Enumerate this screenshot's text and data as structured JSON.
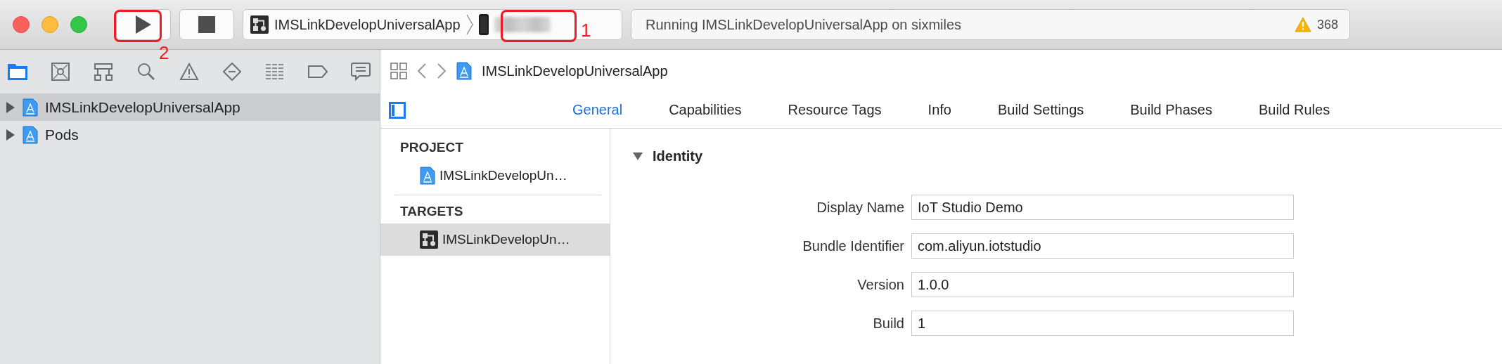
{
  "toolbar": {
    "scheme": "IMSLinkDevelopUniversalApp",
    "activity": "Running IMSLinkDevelopUniversalApp on sixmiles",
    "warning_count": "368"
  },
  "annotations": [
    {
      "kind": "device",
      "label": "1"
    },
    {
      "kind": "run",
      "label": "2"
    }
  ],
  "navigator": {
    "tabs": [
      {
        "kind": "folder",
        "selected": true
      },
      {
        "kind": "source-control",
        "selected": false
      },
      {
        "kind": "hierarchy",
        "selected": false
      },
      {
        "kind": "search",
        "selected": false
      },
      {
        "kind": "warning",
        "selected": false
      },
      {
        "kind": "breakpoint",
        "selected": false
      },
      {
        "kind": "report",
        "selected": false
      },
      {
        "kind": "tag",
        "selected": false
      },
      {
        "kind": "comment",
        "selected": false
      }
    ],
    "items": [
      {
        "label": "IMSLinkDevelopUniversalApp",
        "selected": true,
        "expanded": false
      },
      {
        "label": "Pods",
        "selected": false,
        "expanded": false
      }
    ]
  },
  "editor": {
    "jump_bar": {
      "path": "IMSLinkDevelopUniversalApp"
    },
    "tabs": [
      {
        "label": "General",
        "selected": true
      },
      {
        "label": "Capabilities",
        "selected": false
      },
      {
        "label": "Resource Tags",
        "selected": false
      },
      {
        "label": "Info",
        "selected": false
      },
      {
        "label": "Build Settings",
        "selected": false
      },
      {
        "label": "Build Phases",
        "selected": false
      },
      {
        "label": "Build Rules",
        "selected": false
      }
    ],
    "project_list": [
      {
        "title": "PROJECT",
        "items": [
          {
            "label": "IMSLinkDevelopUn…",
            "kind": "project",
            "selected": false
          }
        ]
      },
      {
        "title": "TARGETS",
        "items": [
          {
            "label": "IMSLinkDevelopUn…",
            "kind": "target",
            "selected": true
          }
        ]
      }
    ],
    "section": {
      "title": "Identity",
      "expanded": true,
      "fields": [
        {
          "label": "Display Name",
          "value": "IoT Studio Demo"
        },
        {
          "label": "Bundle Identifier",
          "value": "com.aliyun.iotstudio"
        },
        {
          "label": "Version",
          "value": "1.0.0"
        },
        {
          "label": "Build",
          "value": "1"
        }
      ]
    }
  }
}
